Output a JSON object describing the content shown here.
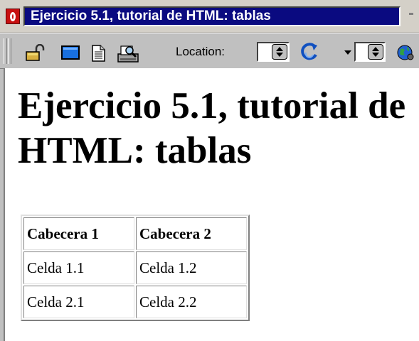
{
  "window": {
    "title": "Ejercicio 5.1, tutorial de HTML: tablas"
  },
  "toolbar": {
    "location_label": "Location:",
    "icons": [
      "lock-icon",
      "window-icon",
      "document-icon",
      "print-preview-icon",
      "refresh-icon",
      "globe-icon"
    ]
  },
  "page": {
    "heading": "Ejercicio 5.1, tutorial de HTML: tablas",
    "table": {
      "headers": [
        "Cabecera 1",
        "Cabecera 2"
      ],
      "rows": [
        [
          "Celda 1.1",
          "Celda 1.2"
        ],
        [
          "Celda 2.1",
          "Celda 2.2"
        ]
      ]
    }
  }
}
